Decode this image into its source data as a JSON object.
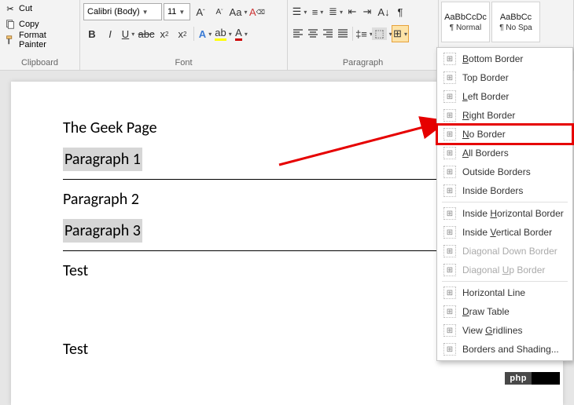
{
  "clipboard": {
    "cut": "Cut",
    "copy": "Copy",
    "format_painter": "Format Painter",
    "group_label": "Clipboard"
  },
  "font": {
    "name": "Calibri (Body)",
    "size": "11",
    "group_label": "Font",
    "bold": "B",
    "italic": "I",
    "underline": "U",
    "strike": "abc",
    "sub": "x",
    "sup": "x"
  },
  "paragraph": {
    "group_label": "Paragraph"
  },
  "styles": {
    "items": [
      {
        "preview": "AaBbCcDc",
        "name": "¶ Normal"
      },
      {
        "preview": "AaBbCc",
        "name": "¶ No Spa"
      }
    ]
  },
  "border_menu": {
    "items": [
      {
        "label": "Bottom Border",
        "u": "B"
      },
      {
        "label": "Top Border",
        "u": ""
      },
      {
        "label": "Left Border",
        "u": "L"
      },
      {
        "label": "Right Border",
        "u": "R"
      },
      {
        "label": "No Border",
        "u": "N",
        "hl": true
      },
      {
        "label": "All Borders",
        "u": "A"
      },
      {
        "label": "Outside Borders",
        "u": ""
      },
      {
        "label": "Inside Borders",
        "u": ""
      }
    ],
    "items2": [
      {
        "label": "Inside Horizontal Border",
        "u": "H"
      },
      {
        "label": "Inside Vertical Border",
        "u": "V"
      },
      {
        "label": "Diagonal Down Border",
        "u": "",
        "dim": true
      },
      {
        "label": "Diagonal Up Border",
        "u": "U",
        "dim": true
      }
    ],
    "items3": [
      {
        "label": "Horizontal Line",
        "u": ""
      },
      {
        "label": "Draw Table",
        "u": "D"
      },
      {
        "label": "View Gridlines",
        "u": "G"
      },
      {
        "label": "Borders and Shading...",
        "u": ""
      }
    ]
  },
  "document": {
    "title": "The Geek Page",
    "p1": "Paragraph 1",
    "p2": "Paragraph 2",
    "p3": "Paragraph 3",
    "t1": "Test",
    "t2": "Test"
  },
  "badge": {
    "text": "php"
  }
}
